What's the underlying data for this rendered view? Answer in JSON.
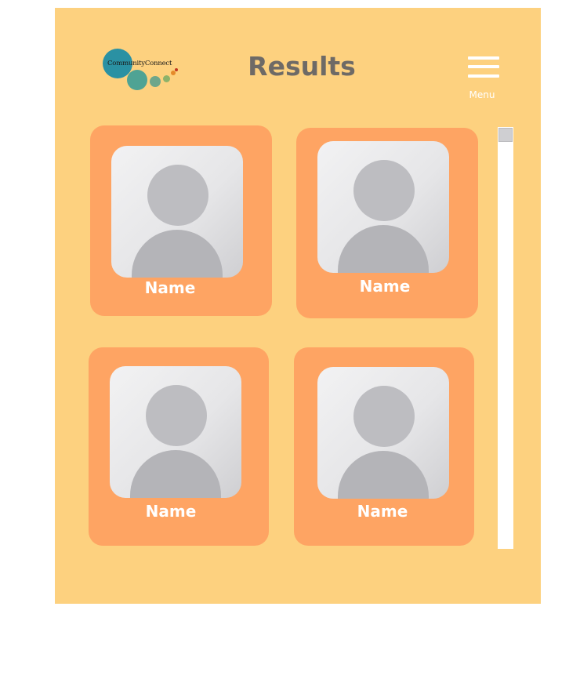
{
  "header": {
    "logo_text": "CommunityConnect",
    "title": "Results",
    "menu_label": "Menu"
  },
  "results": [
    {
      "name": "Name"
    },
    {
      "name": "Name"
    },
    {
      "name": "Name"
    },
    {
      "name": "Name"
    }
  ],
  "colors": {
    "screen_background": "#fdd17f",
    "card_background": "#fea463",
    "title_text": "#6e6a66",
    "logo_teal": "#2a91a3",
    "logo_green": "#4fa394",
    "logo_lime": "#8db26a",
    "logo_orange": "#e58a2a",
    "logo_red": "#c2361e"
  }
}
